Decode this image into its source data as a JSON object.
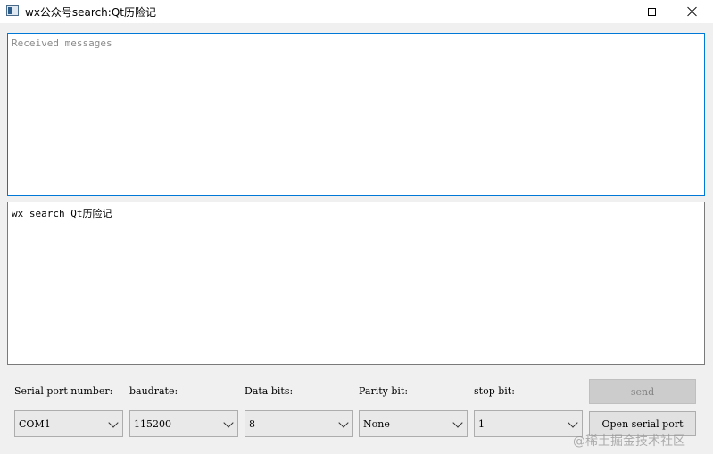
{
  "window": {
    "title": "wx公众号search:Qt历险记",
    "icons": {
      "app": "app-window-icon",
      "minimize": "minimize-icon",
      "maximize": "maximize-icon",
      "close": "close-icon"
    }
  },
  "receive_area": {
    "placeholder": "Received messages",
    "value": ""
  },
  "send_area": {
    "value": "wx search Qt历险记"
  },
  "settings": {
    "port_label": "Serial port number:",
    "port_value": "COM1",
    "baud_label": "baudrate:",
    "baud_value": "115200",
    "databits_label": "Data bits:",
    "databits_value": "8",
    "parity_label": "Parity bit:",
    "parity_value": "None",
    "stopbit_label": "stop bit:",
    "stopbit_value": "1"
  },
  "buttons": {
    "send": "send",
    "open_port": "Open serial port"
  },
  "watermark": "@稀土掘金技术社区",
  "colors": {
    "focus_border": "#0078d7",
    "window_bg": "#f0f0f0",
    "disabled_text": "#838383"
  }
}
